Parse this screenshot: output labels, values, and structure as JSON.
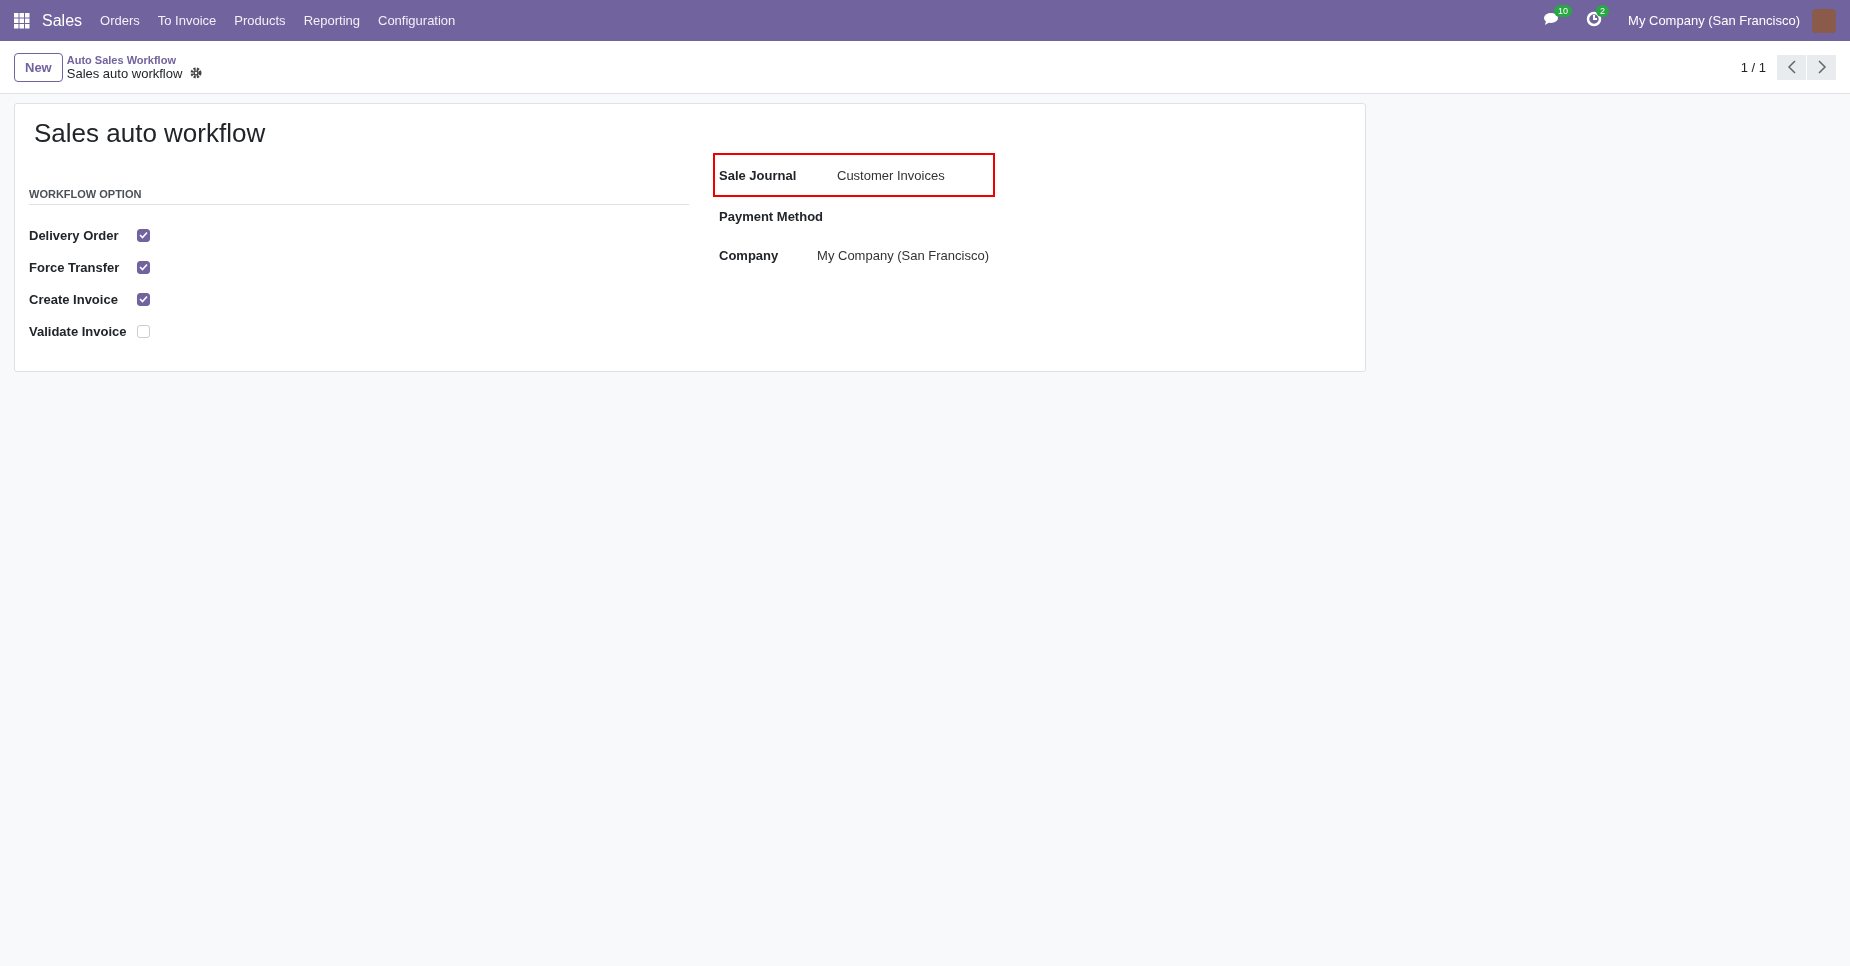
{
  "navbar": {
    "app": "Sales",
    "menu": [
      "Orders",
      "To Invoice",
      "Products",
      "Reporting",
      "Configuration"
    ],
    "messages_count": "10",
    "activities_count": "2",
    "company": "My Company (San Francisco)"
  },
  "control_panel": {
    "new_button": "New",
    "breadcrumb": "Auto Sales Workflow",
    "record_name": "Sales auto workflow",
    "pager": "1 / 1"
  },
  "form": {
    "title": "Sales auto workflow",
    "section": "WORKFLOW OPTION",
    "options": [
      {
        "label": "Delivery Order",
        "checked": true
      },
      {
        "label": "Force Transfer",
        "checked": true
      },
      {
        "label": "Create Invoice",
        "checked": true
      },
      {
        "label": "Validate Invoice",
        "checked": false
      }
    ],
    "fields": [
      {
        "label": "Sale Journal",
        "value": "Customer Invoices",
        "highlighted": true
      },
      {
        "label": "Payment Method",
        "highlighted": false
      },
      {
        "label": "Company",
        "value": "My Company (San Francisco)",
        "highlighted": false
      }
    ]
  }
}
